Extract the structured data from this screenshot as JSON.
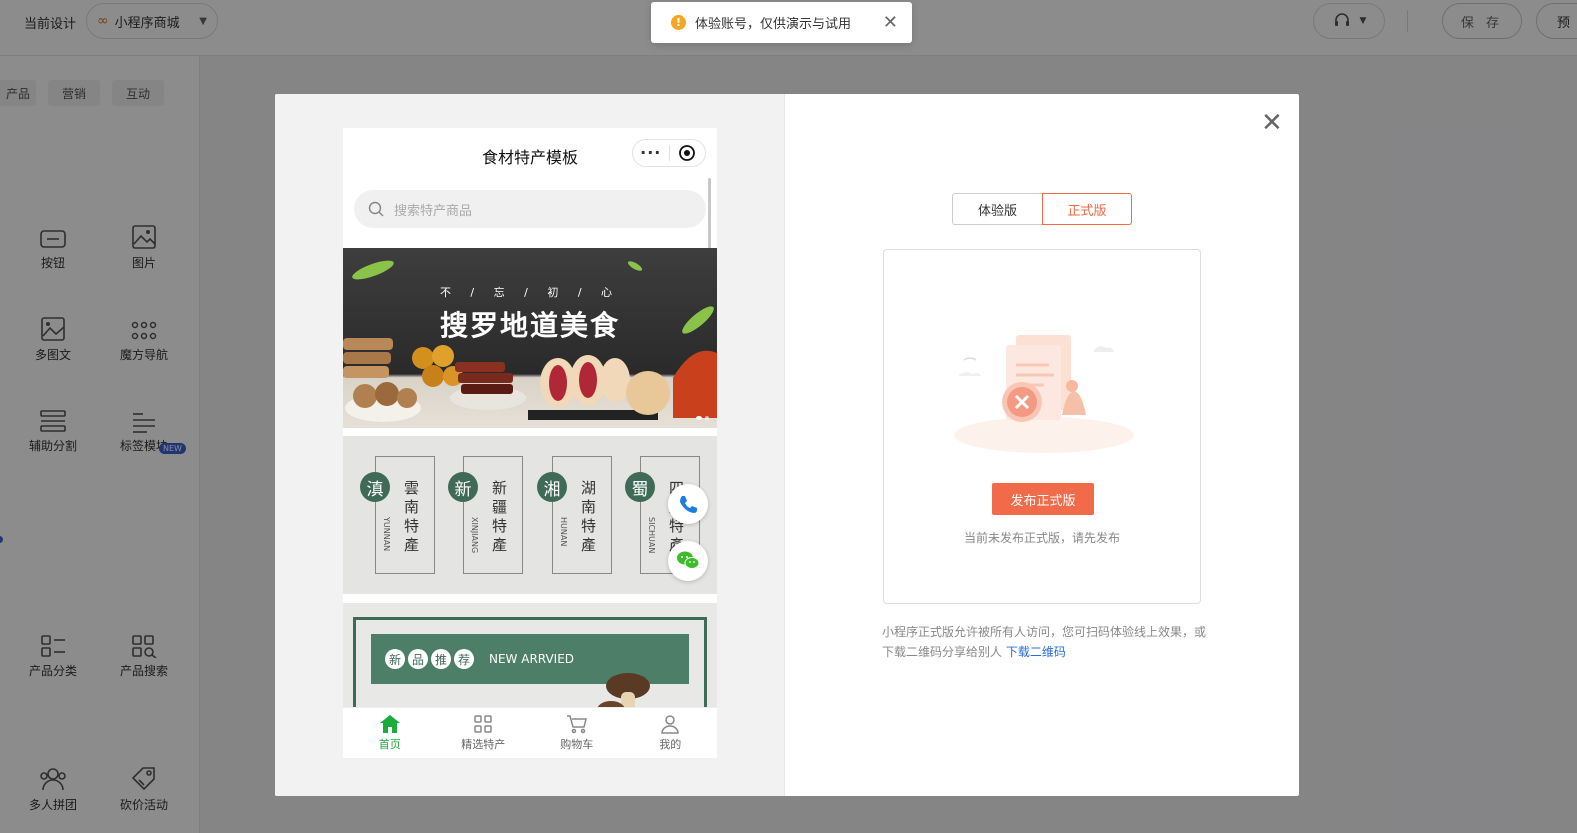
{
  "topbar": {
    "current_design_label": "当前设计",
    "design_select_value": "小程序商城",
    "save_label": "保 存",
    "preview_label": "预"
  },
  "sidebar": {
    "categories": [
      "产品",
      "营销",
      "互动"
    ],
    "components": [
      {
        "label": "按钮",
        "icon": "button-icon"
      },
      {
        "label": "图片",
        "icon": "image-icon"
      },
      {
        "label": "多图文",
        "icon": "multi-image-text-icon"
      },
      {
        "label": "魔方导航",
        "icon": "grid-nav-icon"
      },
      {
        "label": "辅助分割",
        "icon": "divider-icon"
      },
      {
        "label": "标签模块",
        "icon": "tag-module-icon"
      },
      {
        "label": "产品分类",
        "icon": "product-category-icon"
      },
      {
        "label": "产品搜索",
        "icon": "product-search-icon"
      },
      {
        "label": "多人拼团",
        "icon": "group-buy-icon"
      },
      {
        "label": "砍价活动",
        "icon": "bargain-icon"
      }
    ],
    "new_badge": "NEW"
  },
  "toast": {
    "text": "体验账号，仅供演示与试用"
  },
  "preview": {
    "app_title": "食材特产模板",
    "search_placeholder": "搜索特产商品",
    "banner_small": "不 / 忘 / 初 / 心",
    "banner_big": "搜罗地道美食",
    "regions": [
      {
        "char": "滇",
        "name": "雲南特產",
        "pinyin": "YUNNAN"
      },
      {
        "char": "新",
        "name": "新疆特產",
        "pinyin": "XINJIANG"
      },
      {
        "char": "湘",
        "name": "湖南特產",
        "pinyin": "HUNAN"
      },
      {
        "char": "蜀",
        "name": "四川特產",
        "pinyin": "SICHUAN"
      }
    ],
    "new_section": {
      "chars": [
        "新",
        "品",
        "推",
        "荐"
      ],
      "en": "NEW ARRVIED"
    },
    "tabs": [
      {
        "label": "首页",
        "icon": "home-icon",
        "active": true
      },
      {
        "label": "精选特产",
        "icon": "grid-icon",
        "active": false
      },
      {
        "label": "购物车",
        "icon": "cart-icon",
        "active": false
      },
      {
        "label": "我的",
        "icon": "user-icon",
        "active": false
      }
    ],
    "accent_color": "#1aab3a"
  },
  "release": {
    "tabs": [
      "体验版",
      "正式版"
    ],
    "active_tab": "正式版",
    "publish_button": "发布正式版",
    "hint": "当前未发布正式版，请先发布",
    "description": "小程序正式版允许被所有人访问，您可扫码体验线上效果，或下载二维码分享给别人",
    "download_link": "下载二维码",
    "accent_color": "#f16b4a"
  }
}
